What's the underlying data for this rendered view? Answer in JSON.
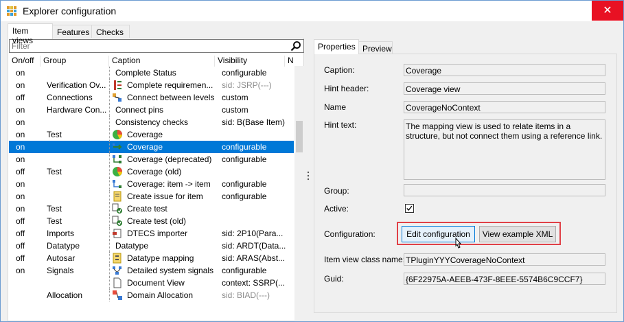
{
  "window": {
    "title": "Explorer configuration",
    "close_glyph": "✕"
  },
  "left_tabs": [
    {
      "label": "Item views",
      "active": true
    },
    {
      "label": "Features",
      "active": false
    },
    {
      "label": "Checks",
      "active": false
    }
  ],
  "filter": {
    "placeholder": "Filter",
    "value": ""
  },
  "grid": {
    "columns": [
      "On/off",
      "Group",
      "Caption",
      "Visibility",
      "Nam"
    ],
    "selected_index": 6,
    "rows": [
      {
        "onoff": "on",
        "group": "",
        "icon": "none",
        "caption": "Complete Status",
        "visibility": "configurable",
        "vis_grey": false
      },
      {
        "onoff": "on",
        "group": "Verification Ov...",
        "icon": "requirements-icon",
        "caption": "Complete requiremen...",
        "visibility": "sid: JSRP(---)",
        "vis_grey": true
      },
      {
        "onoff": "off",
        "group": "Connections",
        "icon": "connect-levels-icon",
        "caption": "Connect between levels",
        "visibility": "custom",
        "vis_grey": false
      },
      {
        "onoff": "on",
        "group": "Hardware Con...",
        "icon": "none",
        "caption": "Connect pins",
        "visibility": "custom",
        "vis_grey": false
      },
      {
        "onoff": "on",
        "group": "",
        "icon": "none",
        "caption": "Consistency checks",
        "visibility": "sid: B(Base Item)",
        "vis_grey": false
      },
      {
        "onoff": "on",
        "group": "Test",
        "icon": "coverage-pie-icon",
        "caption": "Coverage",
        "visibility": "",
        "vis_grey": false
      },
      {
        "onoff": "on",
        "group": "",
        "icon": "coverage-arrow-icon",
        "caption": "Coverage",
        "visibility": "configurable",
        "vis_grey": false
      },
      {
        "onoff": "on",
        "group": "",
        "icon": "coverage-deprecated-icon",
        "caption": "Coverage (deprecated)",
        "visibility": "configurable",
        "vis_grey": false
      },
      {
        "onoff": "off",
        "group": "Test",
        "icon": "coverage-pie-icon",
        "caption": "Coverage (old)",
        "visibility": "",
        "vis_grey": false
      },
      {
        "onoff": "on",
        "group": "",
        "icon": "coverage-item-icon",
        "caption": "Coverage: item -> item",
        "visibility": "configurable",
        "vis_grey": false
      },
      {
        "onoff": "on",
        "group": "",
        "icon": "create-issue-icon",
        "caption": "Create issue for item",
        "visibility": "configurable",
        "vis_grey": false
      },
      {
        "onoff": "on",
        "group": "Test",
        "icon": "create-test-icon",
        "caption": "Create test",
        "visibility": "",
        "vis_grey": false
      },
      {
        "onoff": "off",
        "group": "Test",
        "icon": "create-test-icon",
        "caption": "Create test (old)",
        "visibility": "",
        "vis_grey": false
      },
      {
        "onoff": "off",
        "group": "Imports",
        "icon": "import-icon",
        "caption": "DTECS importer",
        "visibility": "sid: 2P10(Para...",
        "vis_grey": false
      },
      {
        "onoff": "off",
        "group": "Datatype",
        "icon": "none",
        "caption": "Datatype",
        "visibility": "sid: ARDT(Data...",
        "vis_grey": false
      },
      {
        "onoff": "off",
        "group": "Autosar",
        "icon": "datatype-mapping-icon",
        "caption": "Datatype mapping",
        "visibility": "sid: ARAS(Abst...",
        "vis_grey": false
      },
      {
        "onoff": "on",
        "group": "Signals",
        "icon": "signals-icon",
        "caption": "Detailed system signals",
        "visibility": "configurable",
        "vis_grey": false
      },
      {
        "onoff": "",
        "group": "",
        "icon": "document-icon",
        "caption": "Document View",
        "visibility": "context: SSRP(...",
        "vis_grey": false
      },
      {
        "onoff": "",
        "group": "Allocation",
        "icon": "allocation-icon",
        "caption": "Domain Allocation",
        "visibility": "sid: BIAD(---)",
        "vis_grey": true
      }
    ]
  },
  "right_tabs": [
    {
      "label": "Properties",
      "active": true
    },
    {
      "label": "Preview",
      "active": false
    }
  ],
  "properties": {
    "caption_label": "Caption:",
    "caption_value": "Coverage",
    "hint_header_label": "Hint header:",
    "hint_header_value": "Coverage view",
    "name_label": "Name",
    "name_value": "CoverageNoContext",
    "hint_text_label": "Hint text:",
    "hint_text_value": "The mapping view is used to relate items in a structure, but not connect them using a reference link.",
    "group_label": "Group:",
    "group_value": "",
    "active_label": "Active:",
    "active_checked": true,
    "configuration_label": "Configuration:",
    "edit_config_label": "Edit configuration",
    "view_xml_label": "View example XML",
    "class_name_label": "Item view class name:",
    "class_name_value": "TPluginYYYCoverageNoContext",
    "guid_label": "Guid:",
    "guid_value": "{6F22975A-AEEB-473F-8EEE-5574B6C9CCF7}"
  },
  "colors": {
    "selection": "#0078d7",
    "highlight_border": "#e04047",
    "close_button": "#e81123"
  }
}
